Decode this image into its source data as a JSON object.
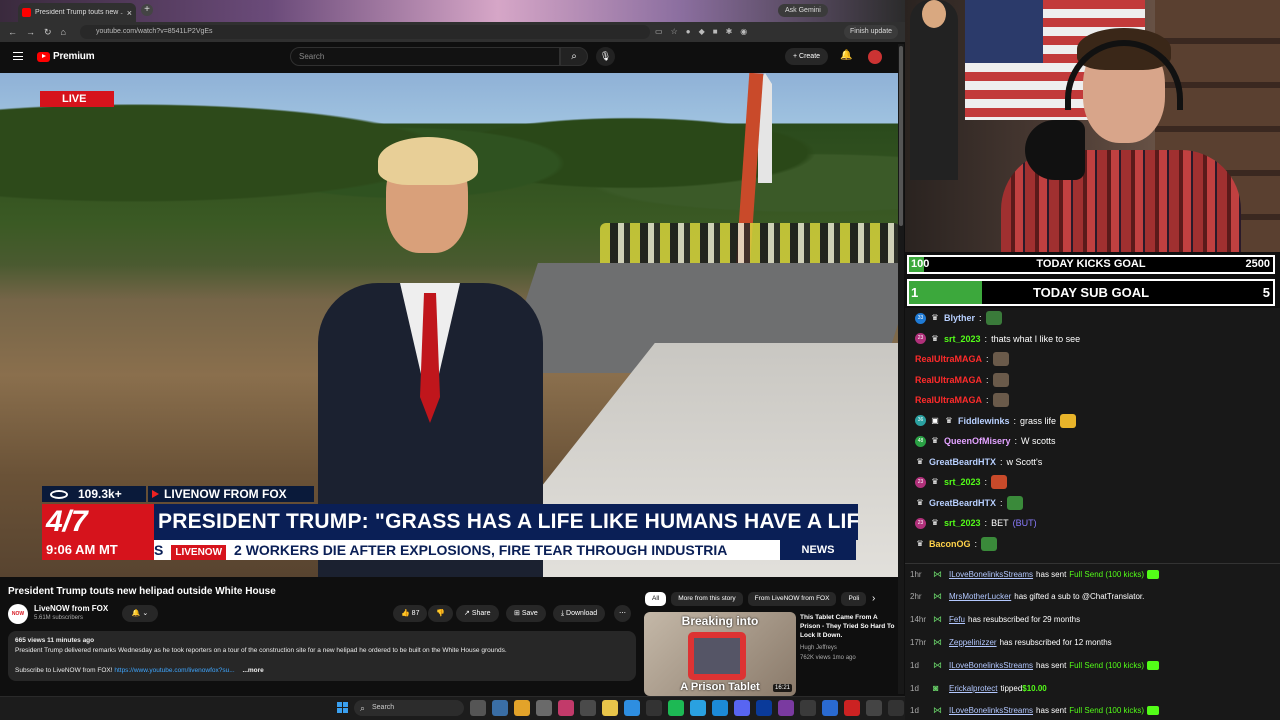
{
  "browser": {
    "tab_title": "President Trump touts new ...",
    "url": "youtube.com/watch?v=8541LP2VgEs",
    "ask_gemini": "Ask Gemini",
    "finish_update": "Finish update"
  },
  "youtube": {
    "logo_text": "Premium",
    "search_placeholder": "Search",
    "create_label": "+ Create"
  },
  "video": {
    "live_label": "LIVE",
    "viewers": "109.3k+",
    "network_tag": "LIVENOW FROM FOX",
    "date": "4/7",
    "headline": "PRESIDENT TRUMP: \"GRASS HAS A LIFE LIKE HUMANS HAVE A LIFE\"",
    "time": "9:06 AM MT",
    "ticker_prefix": "S",
    "ticker_brand": "LIVENOW",
    "ticker_text": "2 WORKERS DIE AFTER EXPLOSIONS, FIRE TEAR THROUGH INDUSTRIA",
    "news_label": "NEWS"
  },
  "details": {
    "title": "President Trump touts new helipad outside White House",
    "channel": "LiveNOW from FOX",
    "subscribers": "5.61M subscribers",
    "likes": "87",
    "share": "Share",
    "save": "Save",
    "download": "Download",
    "stats": "665 views  11 minutes ago",
    "description": "President Trump delivered remarks Wednesday as he took reporters on a tour of the construction site for a new helipad he ordered to be built on the White House grounds.",
    "subscribe_prefix": "Subscribe to LiveNOW from FOX!",
    "subscribe_link": "https://www.youtube.com/livenowfox?su...",
    "more": "...more"
  },
  "related": {
    "chips": [
      "All",
      "More from this story",
      "From LiveNOW from FOX",
      "Poli"
    ],
    "video": {
      "thumb_top": "Breaking into",
      "thumb_bottom": "A Prison Tablet",
      "duration": "16:21",
      "title": "This Tablet Came From A Prison - They Tried So Hard To Lock It Down.",
      "channel": "Hugh Jeffreys",
      "meta": "762K views  1mo ago"
    }
  },
  "taskbar": {
    "search": "Search"
  },
  "goals": {
    "kicks": {
      "current": "100",
      "label": "TODAY KICKS GOAL",
      "target": "2500",
      "progress": 0.04
    },
    "subs": {
      "current": "1",
      "label": "TODAY SUB GOAL",
      "target": "5",
      "progress": 0.2
    }
  },
  "chat": [
    {
      "badge": "33",
      "badge_color": "#1f7ad4",
      "user": "Blyther",
      "user_color": "#b8d0ff",
      "text": "",
      "emote": "#3a7a3a"
    },
    {
      "badge": "23",
      "badge_color": "#b0307a",
      "user": "srt_2023",
      "user_color": "#53fc18",
      "text": "thats what I like to see",
      "emote": ""
    },
    {
      "badge": "",
      "badge_color": "",
      "user": "RealUltraMAGA",
      "user_color": "#ff2b2b",
      "text": "",
      "emote": "#6a5a4a"
    },
    {
      "badge": "",
      "badge_color": "",
      "user": "RealUltraMAGA",
      "user_color": "#ff2b2b",
      "text": "",
      "emote": "#6a5a4a"
    },
    {
      "badge": "",
      "badge_color": "",
      "user": "RealUltraMAGA",
      "user_color": "#ff2b2b",
      "text": "",
      "emote": "#6a5a4a"
    },
    {
      "badge": "36",
      "badge_color": "#2aa1a1",
      "user": "Fiddlewinks",
      "user_color": "#b8d0ff",
      "text": "grass life",
      "emote": "#e8b42a"
    },
    {
      "badge": "48",
      "badge_color": "#2aa144",
      "user": "QueenOfMisery",
      "user_color": "#e2a2ff",
      "text": "W scotts",
      "emote": ""
    },
    {
      "badge": "",
      "badge_color": "",
      "user": "GreatBeardHTX",
      "user_color": "#b8d0ff",
      "text": "w Scott's",
      "emote": ""
    },
    {
      "badge": "23",
      "badge_color": "#b0307a",
      "user": "srt_2023",
      "user_color": "#53fc18",
      "text": "",
      "emote": "#c84a2a"
    },
    {
      "badge": "",
      "badge_color": "",
      "user": "GreatBeardHTX",
      "user_color": "#b8d0ff",
      "text": "",
      "emote": "#3a8a3a"
    },
    {
      "badge": "23",
      "badge_color": "#b0307a",
      "user": "srt_2023",
      "user_color": "#53fc18",
      "text": "BET",
      "extra": "(BUT)",
      "emote": ""
    },
    {
      "badge": "",
      "badge_color": "",
      "user": "BaconOG",
      "user_color": "#ffd24a",
      "text": "",
      "emote": "#3a8a3a"
    }
  ],
  "events": [
    {
      "time": "1hr",
      "user": "ILoveBonelinksStreams",
      "text": "has sent",
      "gift": "Full Send (100 kicks)",
      "kick": true
    },
    {
      "time": "2hr",
      "user": "MrsMotherLucker",
      "text": "has gifted a sub to @ChatTranslator.",
      "gift": "",
      "kick": false
    },
    {
      "time": "14hr",
      "user": "Fefu",
      "text": "has resubscribed for 29 months",
      "gift": "",
      "kick": false
    },
    {
      "time": "17hr",
      "user": "Zeppelinizzer",
      "text": "has resubscribed for 12 months",
      "gift": "",
      "kick": false
    },
    {
      "time": "1d",
      "user": "ILoveBonelinksStreams",
      "text": "has sent",
      "gift": "Full Send (100 kicks)",
      "kick": true
    },
    {
      "time": "1d",
      "user": "Erickalprotect",
      "text": "tipped",
      "gift": "",
      "amount": "$10.00",
      "kick": false
    },
    {
      "time": "1d",
      "user": "ILoveBonelinksStreams",
      "text": "has sent",
      "gift": "Full Send (100 kicks)",
      "kick": true
    }
  ]
}
